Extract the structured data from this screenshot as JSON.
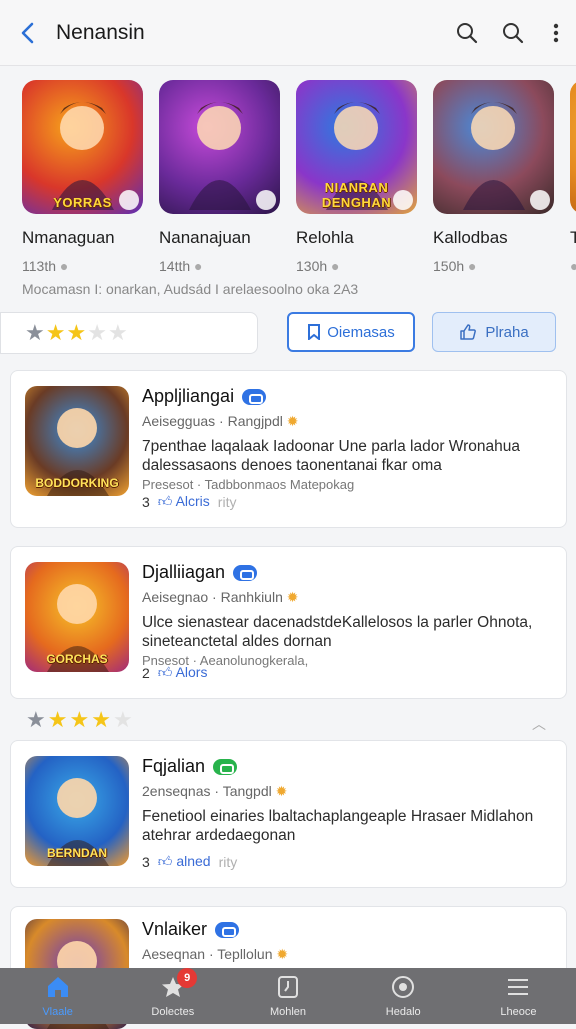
{
  "topbar": {
    "title": "Nenansin"
  },
  "carousel": [
    {
      "name": "Nmanaguan",
      "meta": "113th",
      "tag": "YORRAS",
      "colors": [
        "#f7a21b",
        "#d9372a",
        "#5b2fb8"
      ]
    },
    {
      "name": "Nananajuan",
      "meta": "14tth",
      "tag": "",
      "colors": [
        "#c64bd9",
        "#6a2a9a",
        "#2b1548"
      ]
    },
    {
      "name": "Relohla",
      "meta": "130h",
      "tag": "NIANRAN DENGHAN",
      "colors": [
        "#2d7ae0",
        "#8a36c9",
        "#e2a53b"
      ]
    },
    {
      "name": "Kallodbas",
      "meta": "150h",
      "tag": "",
      "colors": [
        "#4a89d8",
        "#8c4a5c",
        "#3a2a2a"
      ]
    },
    {
      "name": "T",
      "meta": "",
      "tag": "",
      "colors": [
        "#f6b33a",
        "#e58a20",
        "#b85d10"
      ]
    }
  ],
  "carousel_desc": "Mocamasn I: onarkan, Audsád I arelaesoolno oka 2A3",
  "filter": {
    "stars": 2,
    "button_primary": "Oiemasas",
    "button_secondary": "Plraha"
  },
  "cards": [
    {
      "title": "Appljliangai",
      "sub": "Aeisegguas · Rangjpdl",
      "body": "7penthae laqalaak Iadoonar Une parla lador Wronahua dalessasaons denoes taonentanai fkar oma",
      "faint": "Presesot · Tadbbonmaos Matepokag",
      "foot_count": "3",
      "foot_link": "Alcris",
      "foot_ghost": "rity",
      "tag": "BODDORKING",
      "pill": "blue",
      "colors": [
        "#3a8ddb",
        "#6a3b25",
        "#f0a232"
      ]
    },
    {
      "title": "Djalliiagan",
      "sub": "Aeisegnao · Ranhkiuln",
      "body": "Ulce sienastear dacenadstdeKallelosos la parler Ohnota, sineteanctetal aldes dornan",
      "faint": "Pnsesot · Aeanolunogkerala,",
      "foot_count": "2",
      "foot_link": "Alors",
      "foot_ghost": "",
      "tag": "GORCHAS",
      "pill": "blue",
      "colors": [
        "#f7c32a",
        "#e56a1e",
        "#a22b7a"
      ]
    },
    {
      "title": "Fqjalian",
      "sub": "2enseqnas · Tangpdl",
      "body": "Fenetiool einaries lbaltachaplangeaple Hrasaer Midlahon atehrar ardedaegonan",
      "faint": "",
      "foot_count": "3",
      "foot_link": "alned",
      "foot_ghost": "rity",
      "tag": "BERNDAN",
      "pill": "green",
      "colors": [
        "#3aa9e8",
        "#2462c4",
        "#f29a2c"
      ]
    },
    {
      "title": "Vnlaiker",
      "sub": "Aeseqnan · Tepllolun",
      "body": "",
      "faint": "",
      "foot_count": "",
      "foot_link": "",
      "foot_ghost": "",
      "tag": "",
      "pill": "blue",
      "colors": [
        "#6b3ab8",
        "#d88a2a",
        "#2c1b4a"
      ]
    }
  ],
  "mid_stars": 3,
  "bottomnav": [
    {
      "label": "Vlaale",
      "icon": "home-icon",
      "active": true
    },
    {
      "label": "Dolectes",
      "icon": "star-icon",
      "badge": "9"
    },
    {
      "label": "Mohlen",
      "icon": "clock-icon"
    },
    {
      "label": "Hedalo",
      "icon": "download-icon"
    },
    {
      "label": "Lheoce",
      "icon": "menu-icon"
    }
  ]
}
